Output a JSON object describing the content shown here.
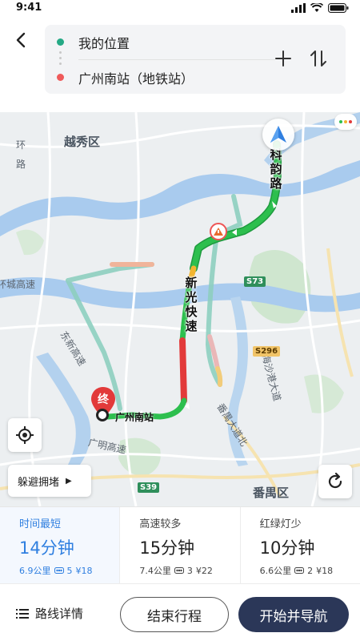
{
  "status_bar": {
    "time": "9:41"
  },
  "route_input": {
    "origin": "我的位置",
    "destination": "广州南站（地铁站）"
  },
  "map": {
    "districts": [
      "越秀区",
      "番禺区"
    ],
    "road_labels": {
      "ring": "环城高速",
      "dongxin": "东新高速",
      "guangming": "广明高速",
      "panyu": "番禺大道北",
      "ring_left": "环",
      "left_road": "路",
      "guangzhou_south": "广州南站",
      "haizhu_east": "海沙港大道"
    },
    "route_vertical_label_1": [
      "科",
      "韵",
      "路"
    ],
    "route_vertical_label_2": [
      "新",
      "光",
      "快",
      "速"
    ],
    "badges": {
      "s73": "S73",
      "s296": "S296",
      "s39": "S39"
    },
    "end_marker": "终",
    "avoid_label": "躲避拥堵"
  },
  "route_options": [
    {
      "tag": "时间最短",
      "time": "14分钟",
      "distance": "6.9公里",
      "lights": "5",
      "fee": "¥18",
      "selected": true
    },
    {
      "tag": "高速较多",
      "time": "15分钟",
      "distance": "7.4公里",
      "lights": "3",
      "fee": "¥22",
      "selected": false
    },
    {
      "tag": "红绿灯少",
      "time": "10分钟",
      "distance": "6.6公里",
      "lights": "2",
      "fee": "¥18",
      "selected": false
    }
  ],
  "bottom_bar": {
    "detail_label": "路线详情",
    "end_label": "结束行程",
    "start_label": "开始并导航"
  },
  "colors": {
    "accent_blue": "#2f7fe0",
    "primary_button": "#2b3758",
    "route_green": "#22b04a",
    "route_red": "#e23a3a",
    "route_yellow": "#f2b530"
  }
}
